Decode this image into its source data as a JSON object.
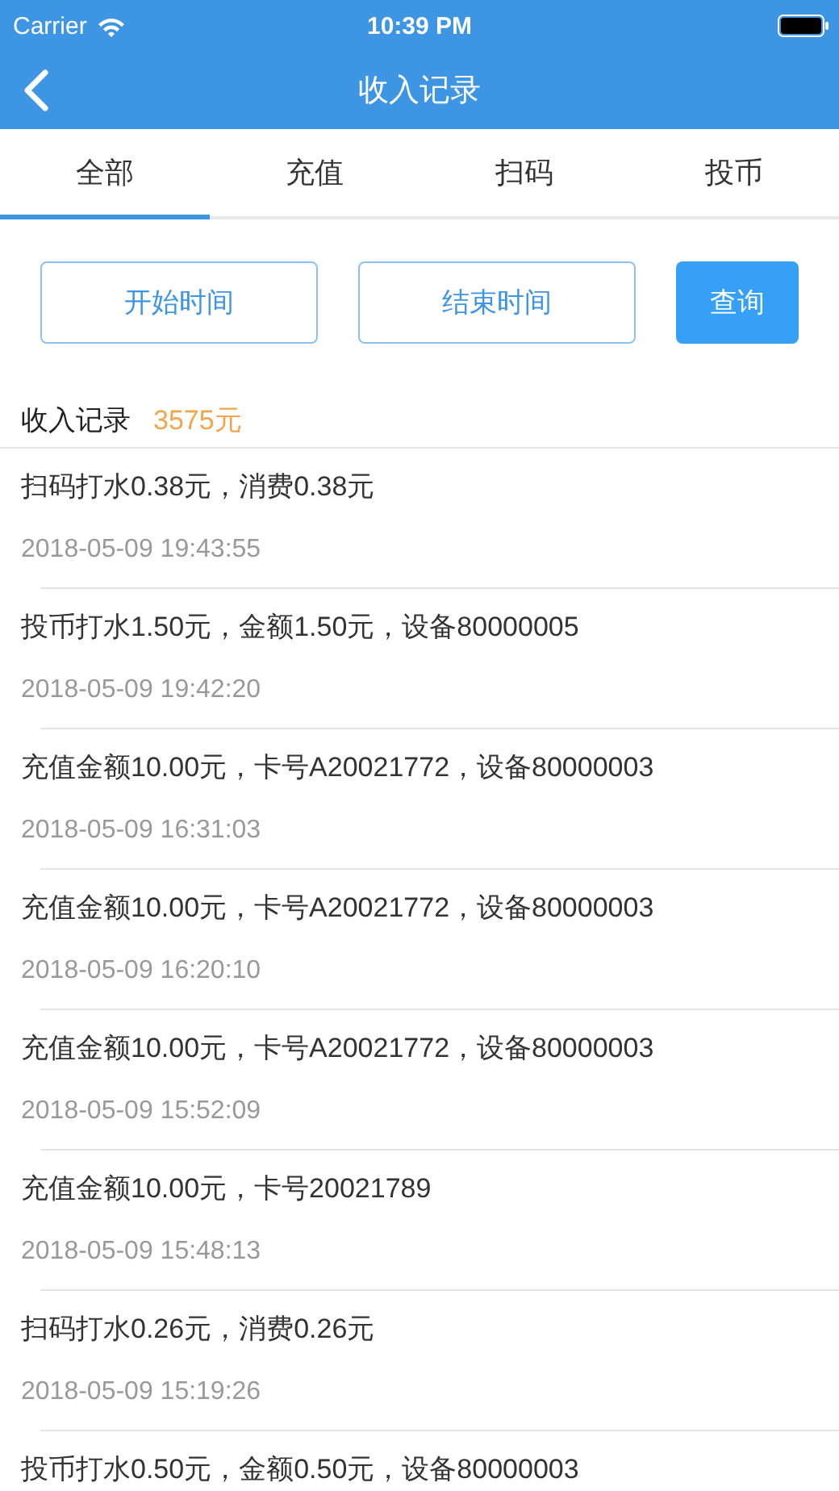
{
  "status_bar": {
    "carrier": "Carrier",
    "time": "10:39 PM"
  },
  "nav": {
    "title": "收入记录"
  },
  "tabs": [
    {
      "label": "全部",
      "selected": true
    },
    {
      "label": "充值",
      "selected": false
    },
    {
      "label": "扫码",
      "selected": false
    },
    {
      "label": "投币",
      "selected": false
    }
  ],
  "filters": {
    "start": "开始时间",
    "end": "结束时间",
    "query": "查询"
  },
  "summary": {
    "label": "收入记录",
    "total": "3575元"
  },
  "records": [
    {
      "text": "扫码打水0.38元，消费0.38元",
      "time": "2018-05-09 19:43:55"
    },
    {
      "text": "投币打水1.50元，金额1.50元，设备80000005",
      "time": "2018-05-09 19:42:20"
    },
    {
      "text": "充值金额10.00元，卡号A20021772，设备80000003",
      "time": "2018-05-09 16:31:03"
    },
    {
      "text": "充值金额10.00元，卡号A20021772，设备80000003",
      "time": "2018-05-09 16:20:10"
    },
    {
      "text": "充值金额10.00元，卡号A20021772，设备80000003",
      "time": "2018-05-09 15:52:09"
    },
    {
      "text": "充值金额10.00元，卡号20021789",
      "time": "2018-05-09 15:48:13"
    },
    {
      "text": "扫码打水0.26元，消费0.26元",
      "time": "2018-05-09 15:19:26"
    },
    {
      "text": "投币打水0.50元，金额0.50元，设备80000003"
    }
  ]
}
